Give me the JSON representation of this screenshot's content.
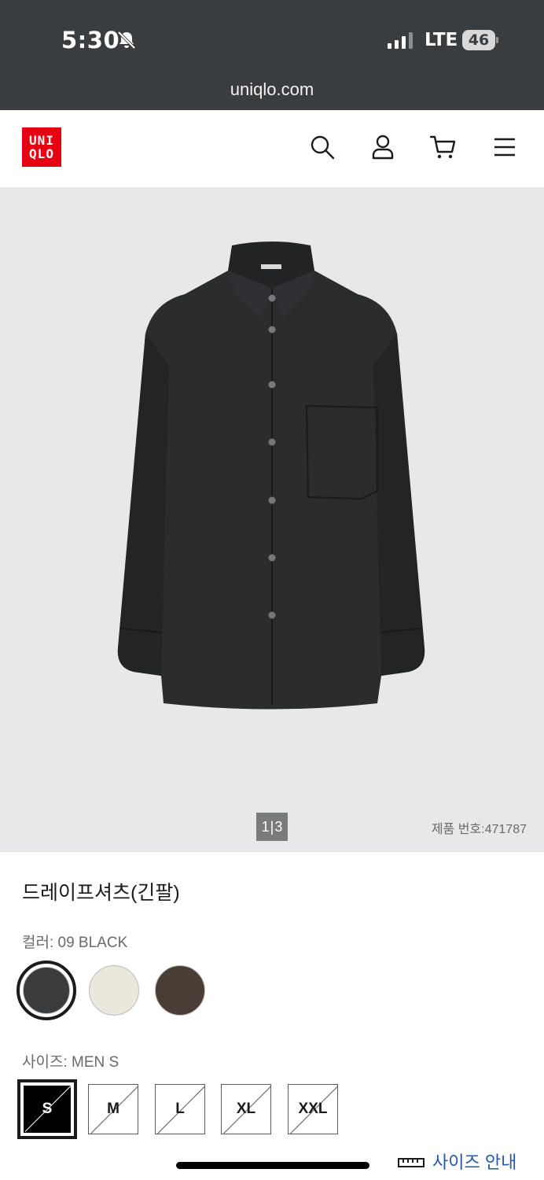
{
  "status_bar": {
    "time": "5:30",
    "network": "LTE",
    "battery": "46"
  },
  "browser": {
    "url": "uniqlo.com"
  },
  "header": {
    "logo_line1": "UNI",
    "logo_line2": "QLO",
    "icons": [
      "search-icon",
      "user-icon",
      "cart-icon",
      "menu-icon"
    ]
  },
  "gallery": {
    "current": "1",
    "separator": "|",
    "total": "3",
    "product_number": "제품 번호:471787"
  },
  "product": {
    "title": "드레이프셔츠(긴팔)",
    "color_label": "컬러: 09 BLACK",
    "colors": [
      {
        "name": "09 BLACK",
        "hex": "#3a3b3d",
        "selected": true
      },
      {
        "name": "ivory",
        "hex": "#ebe7dc",
        "selected": false
      },
      {
        "name": "brown",
        "hex": "#4a3d36",
        "selected": false
      }
    ],
    "size_label": "사이즈: MEN S",
    "sizes": [
      "S",
      "M",
      "L",
      "XL",
      "XXL"
    ],
    "size_guide": "사이즈 안내"
  },
  "colors": {
    "brand_red": "#e60012",
    "chrome": "#3a3d40",
    "link_blue": "#2657a8"
  }
}
